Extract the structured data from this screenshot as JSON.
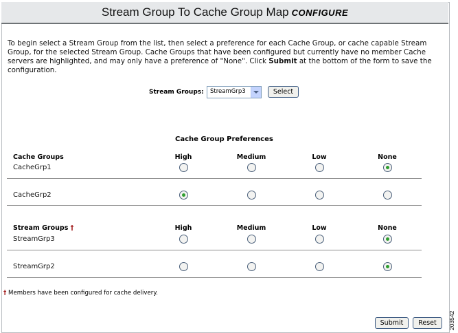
{
  "page": {
    "title_main": "Stream Group To Cache Group Map",
    "title_sub": "CONFIGURE",
    "intro_part1": "To begin select a Stream Group from the list, then select a preference for each Cache Group, or cache capable Stream Group, for the selected Stream Group. Cache Groups that have been configured but currently have no member Cache servers are highlighted, and may only have a preference of \"None\". Click ",
    "intro_bold": "Submit",
    "intro_part2": " at the bottom of the form to save the configuration."
  },
  "stream_select": {
    "label": "Stream Groups:",
    "value": "StreamGrp3",
    "button": "Select"
  },
  "preferences": {
    "heading": "Cache Group Preferences",
    "columns": [
      "High",
      "Medium",
      "Low",
      "None"
    ],
    "cache_header": "Cache Groups",
    "stream_header": "Stream Groups",
    "dagger": "†",
    "cache_rows": [
      {
        "name": "CacheGrp1",
        "selected": "None"
      },
      {
        "name": "CacheGrp2",
        "selected": "High"
      }
    ],
    "stream_rows": [
      {
        "name": "StreamGrp3",
        "selected": "None"
      },
      {
        "name": "StreamGrp2",
        "selected": "None"
      }
    ]
  },
  "footnote": {
    "symbol": "†",
    "text": "Members have been configured for cache delivery."
  },
  "actions": {
    "submit": "Submit",
    "reset": "Reset"
  },
  "side_number": "203542"
}
